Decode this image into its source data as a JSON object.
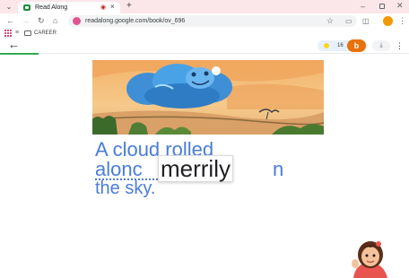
{
  "browser": {
    "tab_title": "Read Along",
    "tab_audio_icon": "speaker-muted-icon",
    "tab_close": "×",
    "new_tab": "+",
    "url": "readalong.google.com/book/ov_696",
    "window_min": "–",
    "window_close": "✕"
  },
  "bookmarks": {
    "label": "CAREER"
  },
  "app": {
    "star_count": "16",
    "badge_letter": "b",
    "back_symbol": "←",
    "menu_symbol": "⋮"
  },
  "story": {
    "line1": "A cloud rolled",
    "line2_start": "alonc",
    "line2_end": "n",
    "line3": "the sky.",
    "popup_word": "merrily"
  },
  "colors": {
    "accent": "#4a7dd9",
    "badge": "#e8710a",
    "progress": "#34a853"
  }
}
